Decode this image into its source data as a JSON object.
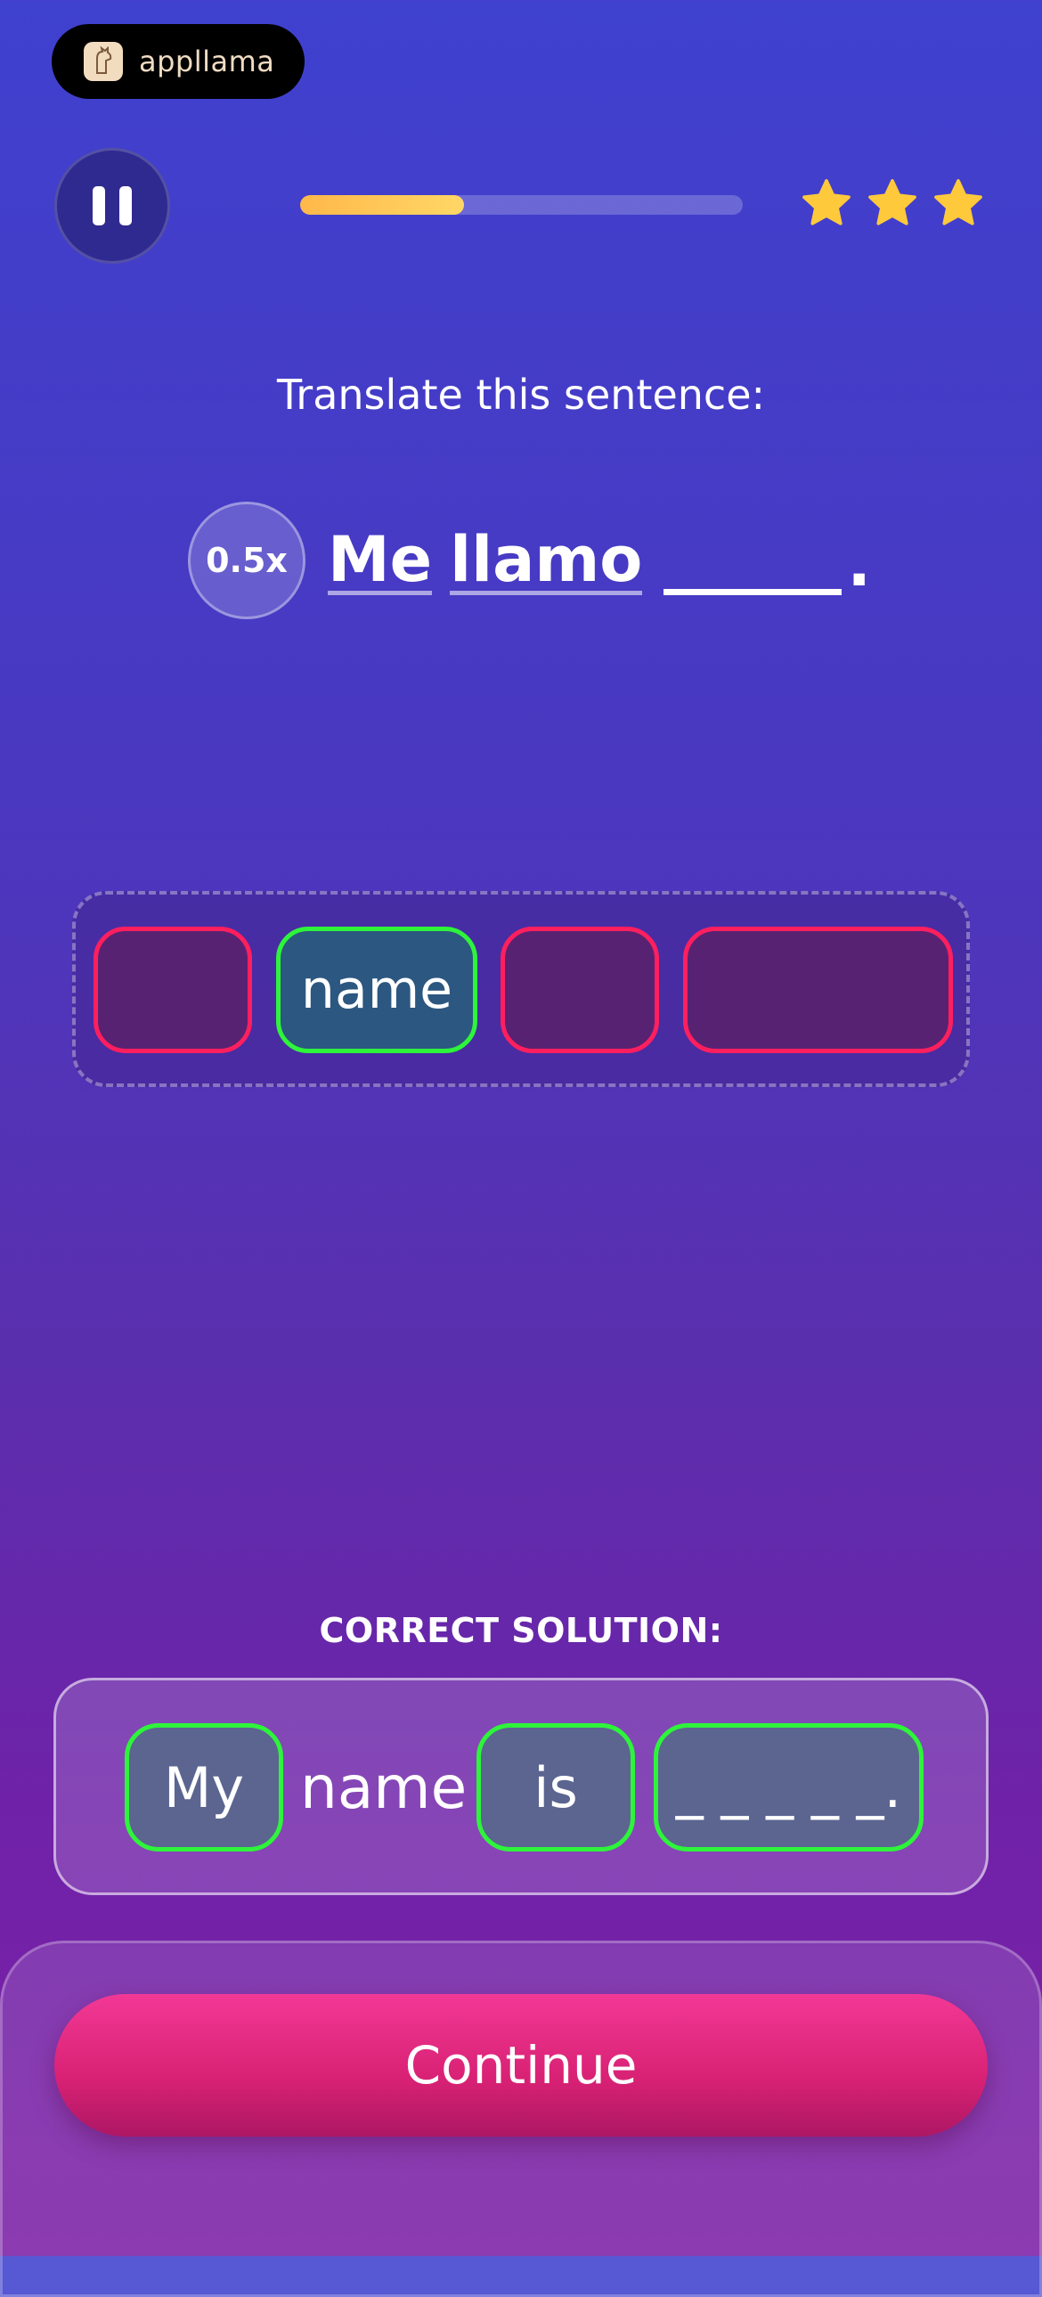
{
  "app": {
    "brand": "appllama"
  },
  "controls": {
    "pause_icon": "pause-icon",
    "speed_label": "0.5x"
  },
  "progress": {
    "fraction": 0.37
  },
  "stars": {
    "count": 3,
    "color": "#ffc93c"
  },
  "prompt": "Translate this sentence:",
  "sentence": {
    "words": [
      "Me",
      "llamo"
    ],
    "period": "."
  },
  "dropzone": {
    "tile_word": "name"
  },
  "solution": {
    "label": "CORRECT SOLUTION:",
    "tokens": [
      "My",
      "name",
      "is",
      "_ _ _ _ _."
    ]
  },
  "action": {
    "continue_label": "Continue"
  },
  "colors": {
    "correct": "#2ef43b",
    "wrong": "#ff1f5f",
    "button": "#e52a82"
  }
}
